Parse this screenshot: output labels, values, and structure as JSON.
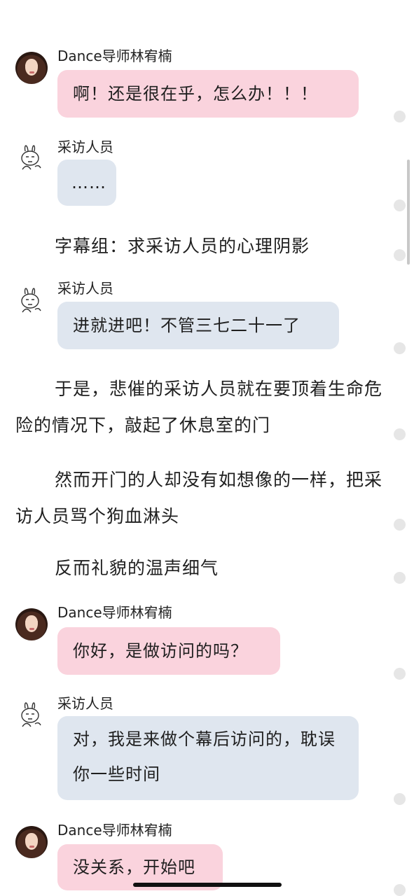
{
  "messages": [
    {
      "name": "Dance导师林宥楠",
      "text": "啊！还是很在乎，怎么办！！！"
    },
    {
      "name": "采访人员",
      "text": "……"
    },
    {
      "name": "采访人员",
      "text": "进就进吧！不管三七二十一了"
    },
    {
      "name": "Dance导师林宥楠",
      "text": "你好，是做访问的吗？"
    },
    {
      "name": "采访人员",
      "text": "对，我是来做个幕后访问的，耽误你一些时间"
    },
    {
      "name": "Dance导师林宥楠",
      "text": "没关系，开始吧"
    }
  ],
  "narration": [
    "字幕组：求采访人员的心理阴影",
    "于是，悲催的采访人员就在要顶着生命危险的情况下，敲起了休息室的门",
    "然而开门的人却没有如想像的一样，把采访人员骂个狗血淋头",
    "反而礼貌的温声细气"
  ],
  "colors": {
    "instructor_bubble": "#fad3dd",
    "interviewer_bubble": "#dfe6ef"
  },
  "icons": {
    "instructor_avatar": "avatar-photo",
    "interviewer_avatar": "rabbit-sticker-icon"
  }
}
